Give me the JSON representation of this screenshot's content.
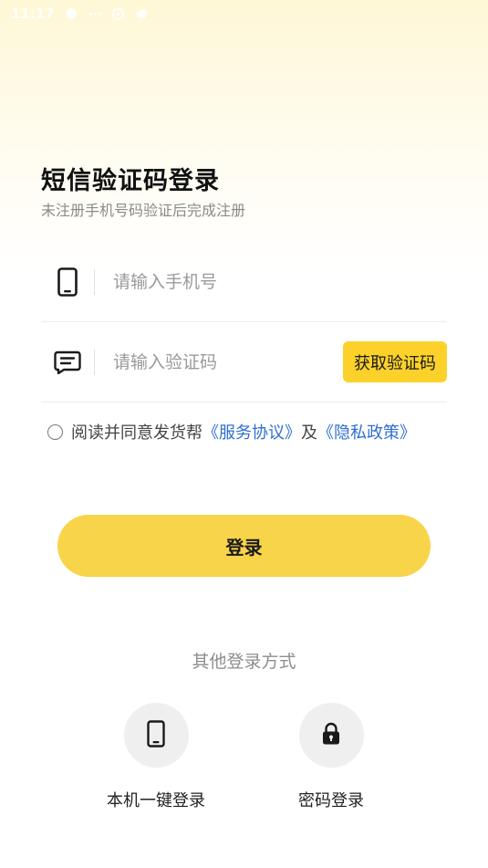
{
  "status_bar": {
    "time": "11:17"
  },
  "header": {
    "title": "短信验证码登录",
    "subtitle": "未注册手机号码验证后完成注册"
  },
  "phone_field": {
    "placeholder": "请输入手机号",
    "value": ""
  },
  "code_field": {
    "placeholder": "请输入验证码",
    "value": "",
    "get_code_label": "获取验证码"
  },
  "agreement": {
    "text_prefix": "阅读并同意发货帮",
    "service_link": "《服务协议》",
    "and_text": "及",
    "privacy_link": "《隐私政策》",
    "checked": false
  },
  "login_button": {
    "label": "登录"
  },
  "other_login": {
    "title": "其他登录方式",
    "options": [
      {
        "label": "本机一键登录",
        "icon": "phone-icon"
      },
      {
        "label": "密码登录",
        "icon": "lock-icon"
      }
    ]
  },
  "colors": {
    "accent": "#fcd22a",
    "login_button": "#f8d44a",
    "link": "#2f6fd1"
  }
}
